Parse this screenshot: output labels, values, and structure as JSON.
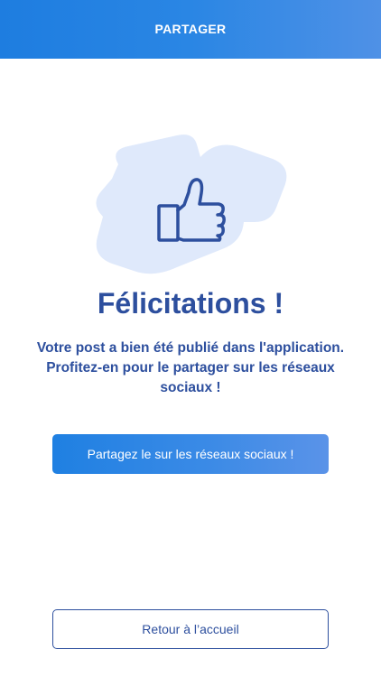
{
  "header": {
    "title": "PARTAGER"
  },
  "illustration": {
    "icon": "thumbs-up-icon",
    "blob_color": "#dfe9fb",
    "icon_color": "#2d4f9e"
  },
  "main": {
    "title": "Félicitations !",
    "message_lines": [
      "Votre post a bien été publié dans l'application.",
      "Profitez-en pour le partager sur les réseaux",
      "sociaux !"
    ]
  },
  "actions": {
    "share_label": "Partagez le sur les réseaux sociaux !",
    "home_label": "Retour à l’accueil"
  },
  "colors": {
    "accent": "#1e7de0",
    "text_primary": "#2d4f9e",
    "background": "#ffffff"
  }
}
